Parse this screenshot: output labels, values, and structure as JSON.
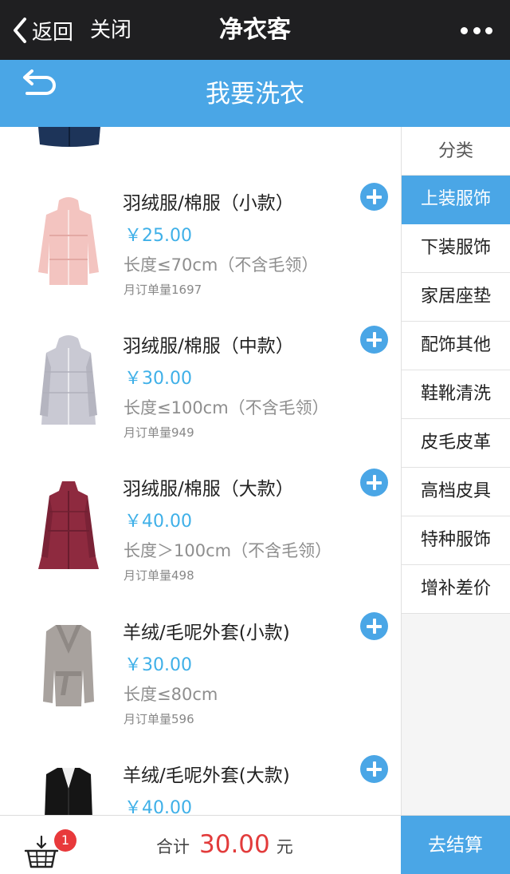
{
  "topbar": {
    "back_label": "返回",
    "close_label": "关闭",
    "title": "净衣客"
  },
  "header": {
    "title": "我要洗衣"
  },
  "products": [
    {
      "name": "羽绒服/棉服（小款）",
      "price": "￥25.00",
      "desc": "长度≤70cm（不含毛领）",
      "monthly": "月订单量1697",
      "color": "#f3c4c0"
    },
    {
      "name": "羽绒服/棉服（中款）",
      "price": "￥30.00",
      "desc": "长度≤100cm（不含毛领）",
      "monthly": "月订单量949",
      "color": "#c9c9d3"
    },
    {
      "name": "羽绒服/棉服（大款）",
      "price": "￥40.00",
      "desc": "长度＞100cm（不含毛领）",
      "monthly": "月订单量498",
      "color": "#8e2a3f"
    },
    {
      "name": "羊绒/毛呢外套(小款)",
      "price": "￥30.00",
      "desc": "长度≤80cm",
      "monthly": "月订单量596",
      "color": "#a8a29e"
    },
    {
      "name": "羊绒/毛呢外套(大款)",
      "price": "￥40.00",
      "desc": "",
      "monthly": "",
      "color": "#151515"
    }
  ],
  "sidebar": {
    "header": "分类",
    "categories": [
      "上装服饰",
      "下装服饰",
      "家居座垫",
      "配饰其他",
      "鞋靴清洗",
      "皮毛皮革",
      "高档皮具",
      "特种服饰",
      "增补差价"
    ]
  },
  "cart": {
    "badge": "1",
    "total_label": "合计",
    "total_amount": "30.00",
    "currency_unit": "元",
    "checkout_label": "去结算"
  },
  "colors": {
    "accent": "#4aa6e6",
    "price": "#3fb0e8",
    "total": "#e23b3b",
    "badge": "#e8393b",
    "topbar": "#1f1f21"
  }
}
